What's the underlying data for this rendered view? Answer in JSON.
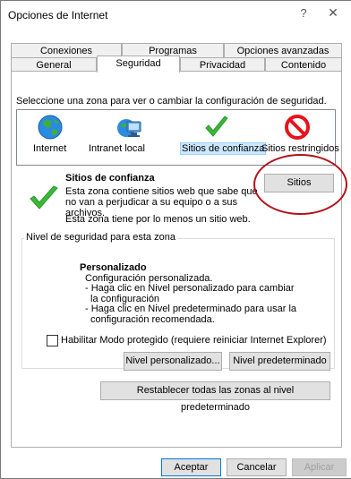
{
  "window": {
    "title": "Opciones de Internet",
    "help_glyph": "?",
    "close_glyph": "✕"
  },
  "tabs": {
    "row1": [
      "Conexiones",
      "Programas",
      "Opciones avanzadas"
    ],
    "row2": [
      "General",
      "Seguridad",
      "Privacidad",
      "Contenido"
    ],
    "active": "Seguridad"
  },
  "zones": {
    "caption": "Seleccione una zona para ver o cambiar la configuración de seguridad.",
    "items": [
      {
        "label": "Internet",
        "icon": "globe-icon"
      },
      {
        "label": "Intranet local",
        "icon": "intranet-icon"
      },
      {
        "label": "Sitios de confianza",
        "icon": "checkmark-icon",
        "selected": true
      },
      {
        "label": "Sitios restringidos",
        "icon": "blocked-icon"
      }
    ]
  },
  "selected_zone": {
    "title": "Sitios de confianza",
    "description": "Esta zona contiene sitios web que sabe que no van a perjudicar a su equipo o a sus archivos.",
    "note": "Esta zona tiene por lo menos un sitio web.",
    "sites_button": "Sitios"
  },
  "security_level": {
    "legend": "Nivel de seguridad para esta zona",
    "title": "Personalizado",
    "lines": [
      "Configuración personalizada.",
      "- Haga clic en Nivel personalizado para cambiar",
      "  la configuración",
      "- Haga clic en Nivel predeterminado para usar la",
      "  configuración recomendada."
    ],
    "protected_mode_label": "Habilitar Modo protegido (requiere reiniciar Internet Explorer)",
    "protected_mode_checked": false,
    "custom_level_button": "Nivel personalizado...",
    "default_level_button": "Nivel predeterminado"
  },
  "reset_all_button": "Restablecer todas las zonas al nivel predeterminado",
  "footer": {
    "accept": "Aceptar",
    "cancel": "Cancelar",
    "apply": "Aplicar"
  },
  "colors": {
    "annotation_circle": "#b3121a",
    "selection_highlight": "#cce8ff",
    "check_green": "#3ab83a",
    "blocked_red": "#e8121d"
  }
}
